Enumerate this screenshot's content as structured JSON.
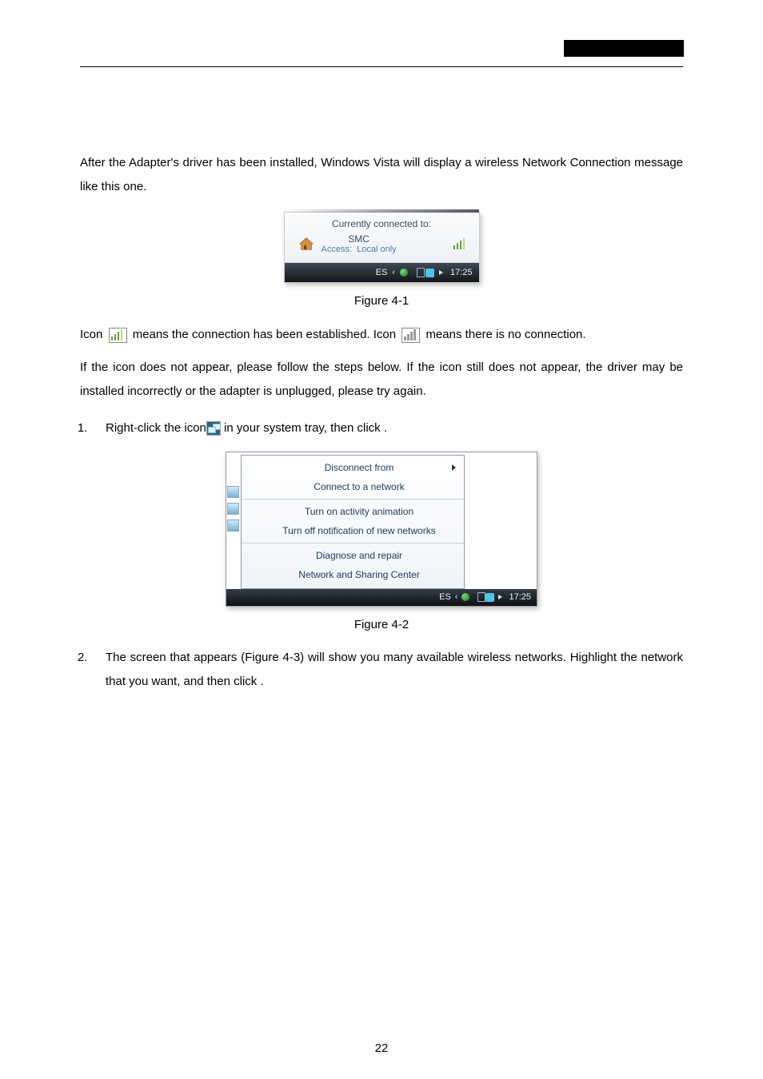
{
  "para1": "After the Adapter's driver has been installed, Windows Vista will display a wireless Network Connection message like this one.",
  "fig1": {
    "tooltip_title": "Currently connected to:",
    "net_name": "SMC",
    "net_access_label": "Access:",
    "net_access_value": "Local only",
    "taskbar": {
      "lang": "ES",
      "time": "17:25"
    },
    "caption": "Figure 4-1"
  },
  "iconline": {
    "lead1": "Icon ",
    "part1": " means the connection has been established. Icon ",
    "part2": " means there is no connection."
  },
  "para2": "If the icon does not appear, please follow the steps below. If the icon still does not appear, the driver may be installed incorrectly or the adapter is unplugged, please try again.",
  "step1": {
    "before": "Right-click the icon",
    "after": " in your system tray, then click ",
    "trailing": "."
  },
  "fig2": {
    "menu": {
      "disconnect": "Disconnect from",
      "connect": "Connect to a network",
      "anim": "Turn on activity animation",
      "notif": "Turn off notification of new networks",
      "diag": "Diagnose and repair",
      "center": "Network and Sharing Center"
    },
    "taskbar": {
      "lang": "ES",
      "time": "17:25"
    },
    "caption": "Figure 4-2"
  },
  "step2": {
    "text_a": "The screen that appears (Figure 4-3) will show you many available wireless networks. Highlight the network that you want, and then click ",
    "trailing": "."
  },
  "page_number": "22"
}
